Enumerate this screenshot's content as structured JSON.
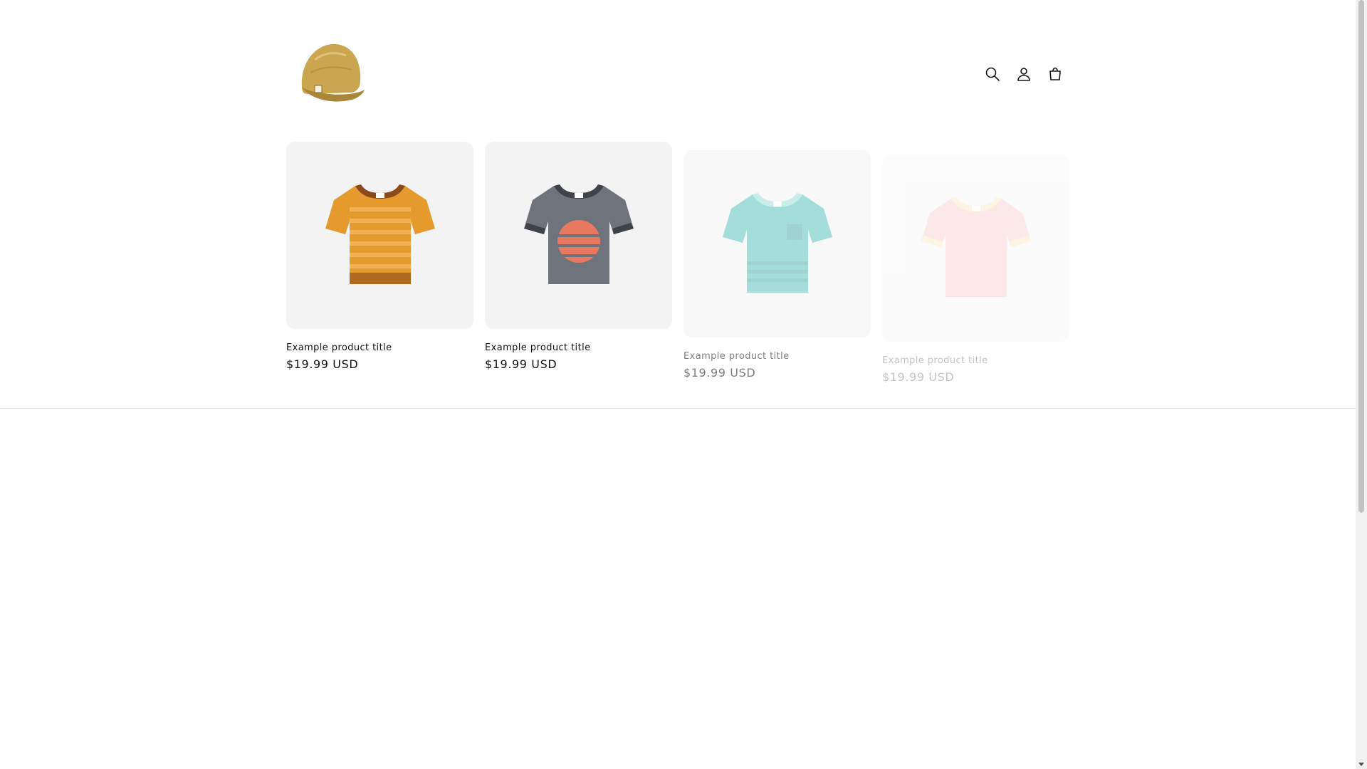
{
  "header": {
    "logo_alt": "Store logo cap",
    "icons": [
      "search-icon",
      "account-icon",
      "cart-icon"
    ]
  },
  "products": [
    {
      "title": "Example product title",
      "price": "$19.99 USD",
      "image": "tshirt-orange-striped"
    },
    {
      "title": "Example product title",
      "price": "$19.99 USD",
      "image": "tshirt-gray-sunset"
    },
    {
      "title": "Example product title",
      "price": "$19.99 USD",
      "image": "tshirt-teal-pocket"
    },
    {
      "title": "Example product title",
      "price": "$19.99 USD",
      "image": "tshirt-pink"
    }
  ],
  "colors": {
    "text": "#121212",
    "card_bg": "#f3f3f3",
    "divider": "#e6e6e6"
  }
}
